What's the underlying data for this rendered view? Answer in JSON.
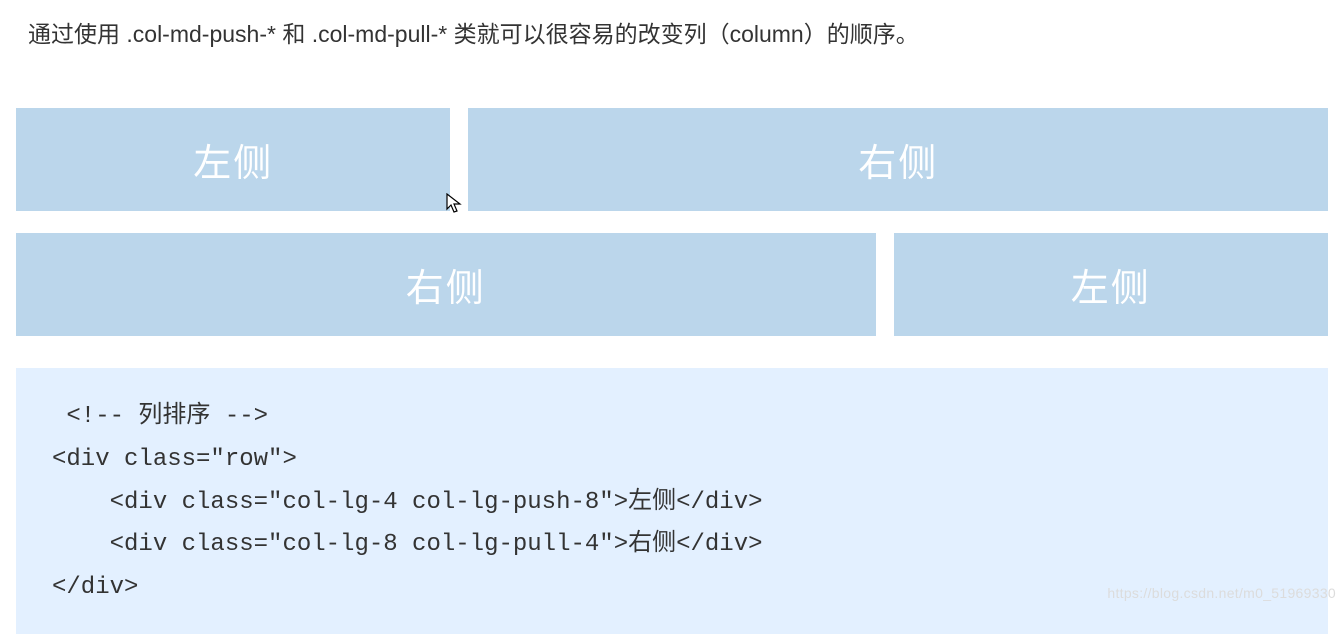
{
  "description": "通过使用 .col-md-push-* 和 .col-md-pull-* 类就可以很容易的改变列（column）的顺序。",
  "grid": {
    "row1": {
      "left": "左侧",
      "right": "右侧"
    },
    "row2": {
      "right": "右侧",
      "left": "左侧"
    }
  },
  "code": {
    "line1": " <!-- 列排序 -->",
    "line2": "<div class=\"row\">",
    "line3": "    <div class=\"col-lg-4 col-lg-push-8\">左侧</div>",
    "line4": "    <div class=\"col-lg-8 col-lg-pull-4\">右侧</div>",
    "line5": "</div>"
  },
  "watermark": "https://blog.csdn.net/m0_51969330"
}
